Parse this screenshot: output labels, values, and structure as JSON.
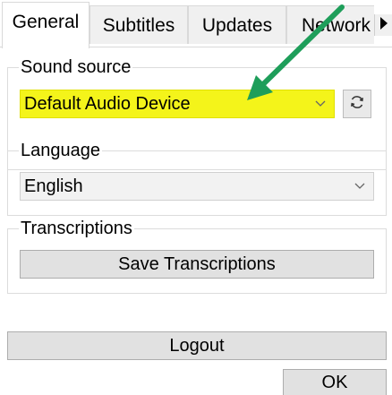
{
  "tabs": [
    {
      "label": "General",
      "active": true
    },
    {
      "label": "Subtitles",
      "active": false
    },
    {
      "label": "Updates",
      "active": false
    },
    {
      "label": "Network",
      "active": false
    }
  ],
  "sound_source": {
    "label": "Sound source",
    "selected": "Default Audio Device",
    "highlight_color": "#f4f41a"
  },
  "language": {
    "label": "Language",
    "selected": "English"
  },
  "transcriptions": {
    "label": "Transcriptions",
    "save_button": "Save Transcriptions"
  },
  "logout_button": "Logout",
  "ok_button": "OK",
  "annotation": {
    "arrow_color": "#1e9e5a"
  },
  "icons": {
    "tab_scroll": "triangle-right-icon",
    "refresh": "refresh-icon",
    "dropdown": "chevron-down-icon"
  }
}
